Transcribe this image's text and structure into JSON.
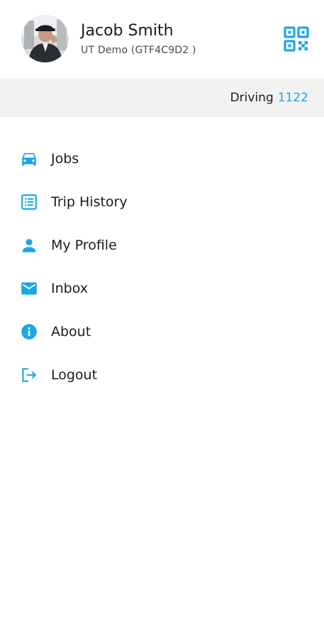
{
  "profile": {
    "name": "Jacob Smith",
    "subtitle": "UT Demo (GTF4C9D2 )",
    "avatar_icon": "user-photo",
    "qr_icon": "qr-code-icon"
  },
  "status": {
    "label": "Driving",
    "value": "1122"
  },
  "menu": {
    "items": [
      {
        "label": "Jobs",
        "icon": "car-icon"
      },
      {
        "label": "Trip History",
        "icon": "list-icon"
      },
      {
        "label": "My Profile",
        "icon": "person-icon"
      },
      {
        "label": "Inbox",
        "icon": "mail-icon"
      },
      {
        "label": "About",
        "icon": "info-icon"
      },
      {
        "label": "Logout",
        "icon": "logout-icon"
      }
    ]
  },
  "colors": {
    "accent": "#1ca6e8",
    "status_bar_bg": "#f2f2f2",
    "text": "#1b1b1b"
  }
}
